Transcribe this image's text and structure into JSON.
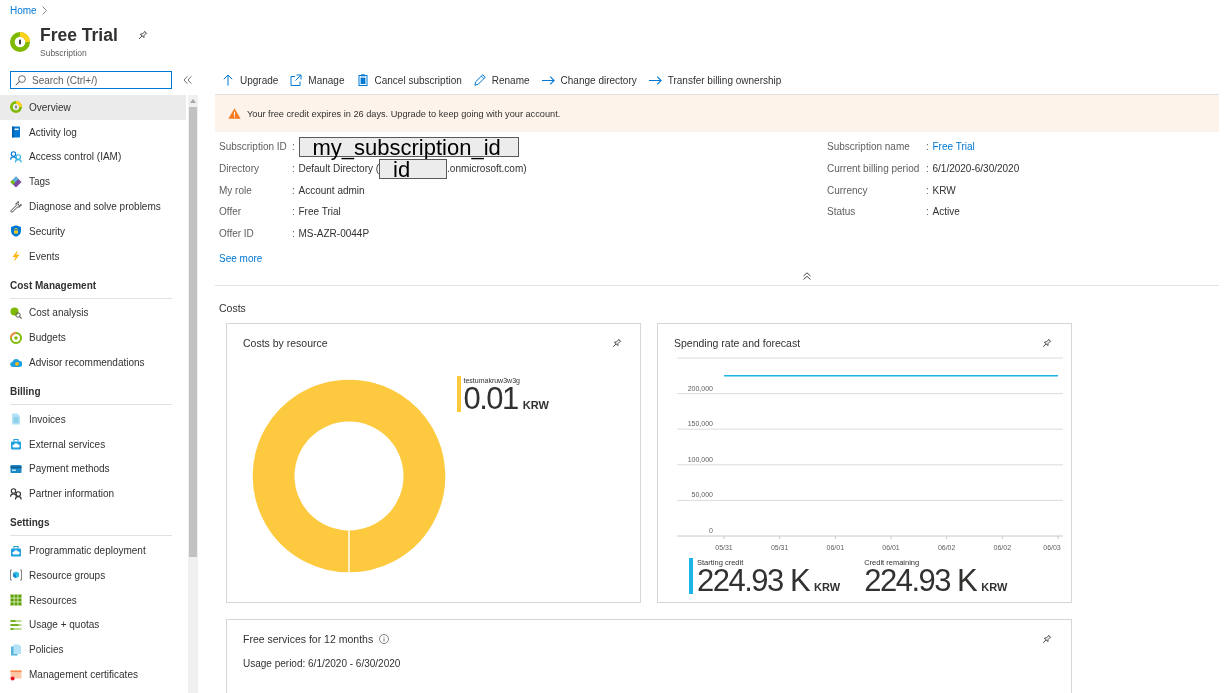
{
  "breadcrumb": {
    "items": [
      {
        "label": "Home"
      }
    ]
  },
  "header": {
    "title": "Free Trial",
    "subtitle": "Subscription"
  },
  "sidebar": {
    "search": {
      "placeholder": "Search (Ctrl+/)"
    },
    "sections": [
      {
        "items": [
          {
            "label": "Overview",
            "selected": true
          },
          {
            "label": "Activity log",
            "selected": false
          },
          {
            "label": "Access control (IAM)",
            "selected": false
          },
          {
            "label": "Tags",
            "selected": false
          },
          {
            "label": "Diagnose and solve problems",
            "selected": false
          },
          {
            "label": "Security",
            "selected": false
          },
          {
            "label": "Events",
            "selected": false
          }
        ]
      },
      {
        "heading": "Cost Management",
        "items": [
          {
            "label": "Cost analysis",
            "selected": false
          },
          {
            "label": "Budgets",
            "selected": false
          },
          {
            "label": "Advisor recommendations",
            "selected": false
          }
        ]
      },
      {
        "heading": "Billing",
        "items": [
          {
            "label": "Invoices",
            "selected": false
          },
          {
            "label": "External services",
            "selected": false
          },
          {
            "label": "Payment methods",
            "selected": false
          },
          {
            "label": "Partner information",
            "selected": false
          }
        ]
      },
      {
        "heading": "Settings",
        "items": [
          {
            "label": "Programmatic deployment",
            "selected": false
          },
          {
            "label": "Resource groups",
            "selected": false
          },
          {
            "label": "Resources",
            "selected": false
          },
          {
            "label": "Usage + quotas",
            "selected": false
          },
          {
            "label": "Policies",
            "selected": false
          },
          {
            "label": "Management certificates",
            "selected": false
          }
        ]
      }
    ]
  },
  "toolbar": {
    "buttons": [
      {
        "label": "Upgrade"
      },
      {
        "label": "Manage"
      },
      {
        "label": "Cancel subscription"
      },
      {
        "label": "Rename"
      },
      {
        "label": "Change directory"
      },
      {
        "label": "Transfer billing ownership"
      }
    ]
  },
  "alert": {
    "text": "Your free credit expires in 26 days. Upgrade to keep going with your account."
  },
  "essentials": {
    "columns": [
      {
        "fields": [
          {
            "label": "Subscription ID",
            "separator": ":",
            "value": [
              {
                "kind": "redaction",
                "text": "my_subscription_id"
              }
            ]
          },
          {
            "label": "Directory",
            "separator": ":",
            "value": [
              {
                "kind": "text",
                "text": "Default Directory ("
              },
              {
                "kind": "redaction",
                "text": "id"
              },
              {
                "kind": "text",
                "text": ".onmicrosoft.com)"
              }
            ]
          },
          {
            "label": "My role",
            "separator": ":",
            "value": [
              {
                "kind": "text",
                "text": "Account admin"
              }
            ]
          },
          {
            "label": "Offer",
            "separator": ":",
            "value": [
              {
                "kind": "text",
                "text": "Free Trial"
              }
            ]
          },
          {
            "label": "Offer ID",
            "separator": ":",
            "value": [
              {
                "kind": "text",
                "text": "MS-AZR-0044P"
              }
            ]
          }
        ]
      },
      {
        "fields": [
          {
            "label": "Subscription name",
            "separator": ":",
            "value": [
              {
                "kind": "link",
                "text": "Free Trial"
              }
            ]
          },
          {
            "label": "Current billing period",
            "separator": ":",
            "value": [
              {
                "kind": "text",
                "text": "6/1/2020-6/30/2020"
              }
            ]
          },
          {
            "label": "Currency",
            "separator": ":",
            "value": [
              {
                "kind": "text",
                "text": "KRW"
              }
            ]
          },
          {
            "label": "Status",
            "separator": ":",
            "value": [
              {
                "kind": "text",
                "text": "Active"
              }
            ]
          }
        ]
      }
    ],
    "see_more": "See more"
  },
  "costs": {
    "heading": "Costs",
    "cards": [
      {
        "kind": "donut",
        "title": "Costs by resource",
        "chart_data": {
          "type": "donut",
          "categories": [
            "testumakruw3w3g"
          ],
          "series": [
            {
              "color": "#fdc93f",
              "values": [
                100
              ]
            }
          ]
        },
        "legend": [
          {
            "amount": "0.01",
            "unit": "KRW"
          }
        ]
      },
      {
        "kind": "line",
        "title": "Spending rate and forecast",
        "chart_data": {
          "type": "line",
          "grid": true,
          "x": [
            "05/31",
            "05/31",
            "06/01",
            "06/01",
            "06/02",
            "06/02",
            "06/03"
          ],
          "ylim": [
            0,
            250000
          ],
          "yticks": [
            {
              "value": 0,
              "label": "0"
            },
            {
              "value": 50000,
              "label": "50,000"
            },
            {
              "value": 100000,
              "label": "100,000"
            },
            {
              "value": 150000,
              "label": "150,000"
            },
            {
              "value": 200000,
              "label": "200,000"
            }
          ],
          "series": [
            {
              "color": "#1db4e8",
              "values": [
                225000,
                225000,
                225000,
                225000,
                225000,
                225000,
                225000
              ]
            }
          ]
        },
        "summary": [
          {
            "label": "Starting credit",
            "amount": "224.93 K",
            "unit": "KRW",
            "marker": true
          },
          {
            "label": "Credit remaining",
            "amount": "224.93 K",
            "unit": "KRW",
            "marker": false
          }
        ]
      },
      {
        "kind": "text",
        "title": "Free services for 12 months",
        "subtitle": "Usage period: 6/1/2020 - 6/30/2020"
      }
    ]
  }
}
